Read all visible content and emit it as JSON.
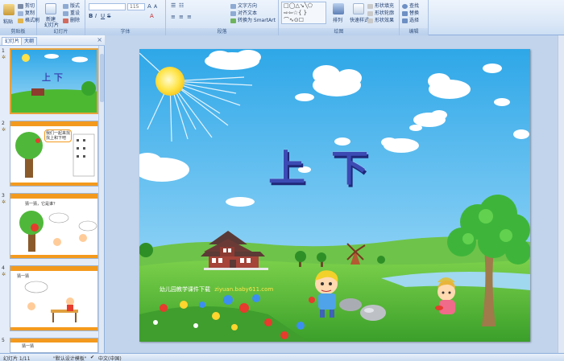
{
  "ribbon": {
    "clipboard": {
      "label": "剪贴板",
      "paste": "粘贴",
      "cut": "剪切",
      "copy": "复制",
      "format_painter": "格式刷"
    },
    "slides": {
      "label": "幻灯片",
      "new_slide": "新建",
      "new_slide2": "幻灯片",
      "layout": "版式",
      "reset": "重设",
      "delete": "删除"
    },
    "font": {
      "label": "字体",
      "font_name": "",
      "font_size": "115"
    },
    "paragraph": {
      "label": "段落",
      "text_direction": "文字方向",
      "align_text": "对齐文本",
      "smartart": "转换为 SmartArt"
    },
    "drawing": {
      "label": "绘图",
      "arrange": "排列",
      "quick_styles": "快速样式",
      "shape_fill": "形状填充",
      "shape_outline": "形状轮廓",
      "shape_effects": "形状效果"
    },
    "editing": {
      "label": "编辑",
      "find": "查找",
      "replace": "替换",
      "select": "选择"
    }
  },
  "left_panel": {
    "tab_slides": "幻灯片",
    "tab_outline": "大纲",
    "thumbnails": [
      {
        "num": "1",
        "title": "上 下",
        "selected": true
      },
      {
        "num": "2",
        "bubble": "我们一起来找找上和下吧"
      },
      {
        "num": "3",
        "bubble": "猜一猜，它是谁？"
      },
      {
        "num": "4",
        "bubble": "猜一猜"
      },
      {
        "num": "5",
        "bubble": "猜一猜"
      }
    ]
  },
  "slide": {
    "title": "上 下",
    "watermark_cn": "幼儿园教学课件下载",
    "watermark_url": "ziyuan.baby611.com"
  },
  "status": {
    "slide_count": "幻灯片 1/11",
    "theme": "\"默认设计模板\"",
    "language": "中文(中国)"
  },
  "colors": {
    "sky_top": "#2ea7e8",
    "sky_bottom": "#9bd8f6",
    "grass": "#4cb832",
    "title_blue": "#3c4bb4",
    "accent_orange": "#e8a23a"
  }
}
